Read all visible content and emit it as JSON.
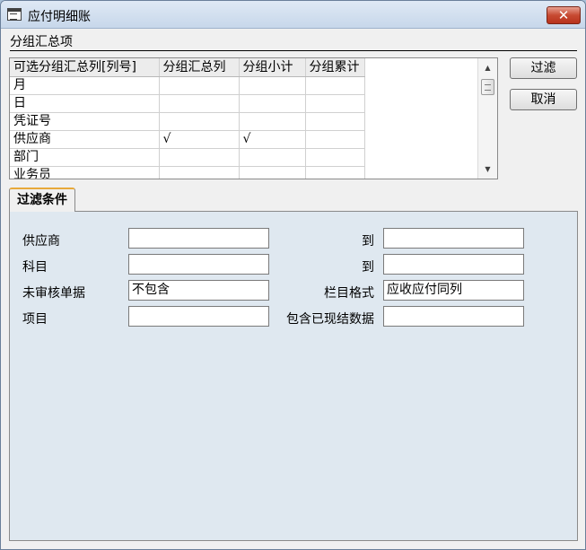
{
  "window": {
    "title": "应付明细账",
    "close_glyph": "✕"
  },
  "group": {
    "section_label": "分组汇总项",
    "columns": [
      "可选分组汇总列[列号]",
      "分组汇总列",
      "分组小计",
      "分组累计"
    ],
    "rows": [
      {
        "name": "月",
        "group": "",
        "subtotal": "",
        "cumulative": ""
      },
      {
        "name": "日",
        "group": "",
        "subtotal": "",
        "cumulative": ""
      },
      {
        "name": "凭证号",
        "group": "",
        "subtotal": "",
        "cumulative": ""
      },
      {
        "name": "供应商",
        "group": "√",
        "subtotal": "√",
        "cumulative": ""
      },
      {
        "name": "部门",
        "group": "",
        "subtotal": "",
        "cumulative": ""
      },
      {
        "name": "业务员",
        "group": "",
        "subtotal": "",
        "cumulative": ""
      }
    ],
    "scroll_up": "▲",
    "scroll_down": "▼"
  },
  "buttons": {
    "filter": "过滤",
    "cancel": "取消"
  },
  "tab": {
    "label": "过滤条件"
  },
  "filters": {
    "supplier_label": "供应商",
    "supplier_value": "",
    "to1_label": "到",
    "to1_value": "",
    "account_label": "科目",
    "account_value": "",
    "to2_label": "到",
    "to2_value": "",
    "unaudited_label": "未审核单据",
    "unaudited_value": "不包含",
    "column_format_label": "栏目格式",
    "column_format_value": "应收应付同列",
    "project_label": "项目",
    "project_value": "",
    "settled_label": "包含已现结数据",
    "settled_value": ""
  }
}
